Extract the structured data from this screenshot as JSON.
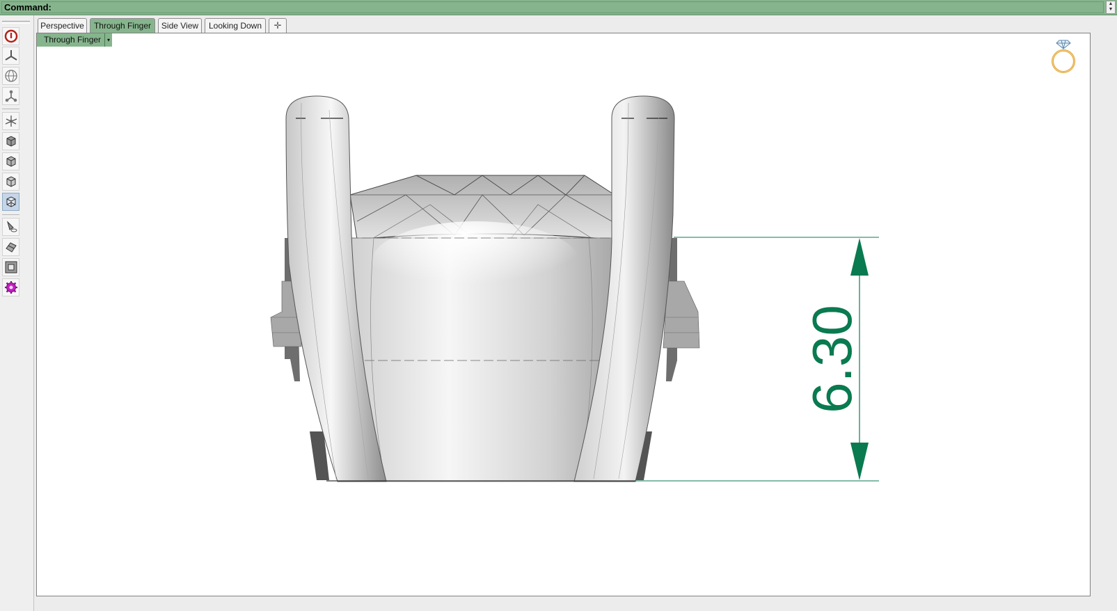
{
  "command_bar": {
    "label": "Command:"
  },
  "toolbar": {
    "buttons": [
      {
        "name": "power-icon"
      },
      {
        "name": "axis-tripod-icon"
      },
      {
        "name": "globe-grid-icon"
      },
      {
        "name": "node-molecule-icon"
      },
      {
        "name": "move-gizmo-icon"
      },
      {
        "name": "shaded-cube-icon"
      },
      {
        "name": "rendered-cube-icon"
      },
      {
        "name": "ghosted-cube-icon"
      },
      {
        "name": "xray-cube-icon"
      },
      {
        "name": "cone-tool-icon"
      },
      {
        "name": "surface-tool-icon"
      },
      {
        "name": "box-frame-icon"
      },
      {
        "name": "gear-plugin-icon"
      }
    ]
  },
  "tabs": [
    {
      "label": "Perspective"
    },
    {
      "label": "Through Finger"
    },
    {
      "label": "Side View"
    },
    {
      "label": "Looking Down"
    },
    {
      "label": "✛"
    }
  ],
  "active_tab": "Through Finger",
  "viewport": {
    "label": "Through Finger",
    "dropdown_glyph": "▾",
    "dimension_value": "6.30",
    "colors": {
      "dimension": "#0a7a50",
      "header_green": "#86b58d",
      "model": "#bfbfbf"
    }
  }
}
